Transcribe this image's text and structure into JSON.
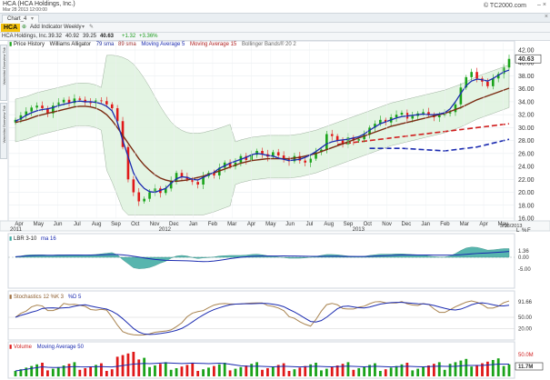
{
  "window": {
    "title": "HCA (HCA Holdings, Inc.)",
    "date": "Mar 28 2013 12:00:00",
    "brand": "© TC2000.com"
  },
  "tab": {
    "label": "Chart_4"
  },
  "toolbar": {
    "symbol": "HCA",
    "add_indicator": "Add Indicator",
    "interval": "Weekly"
  },
  "quote": {
    "name": "HCA Holdings, Inc.",
    "open": "39.32",
    "high": "40.92",
    "low": "39.25",
    "last": "40.63",
    "change": "+1.32",
    "change_pct": "+3.36%"
  },
  "legend_main": {
    "price": "Price History",
    "alligator": "Williams Alligator",
    "sma79": "79 sma",
    "sma89": "89 sma",
    "ma5": "Moving Average 5",
    "ma15": "Moving Average 15",
    "bb": "Bollinger Bands® 20 2"
  },
  "side_tabs": [
    "Watchlist Overview Tab",
    "Watchlist Overview Tab"
  ],
  "legend_lbr": {
    "name": "LBR 3-10",
    "ma": "ma 16"
  },
  "legend_stoch": {
    "name": "Stochastics 12 %K 3",
    "d": "%D 5"
  },
  "legend_vol": {
    "name": "Volume",
    "ma": "Moving Average 50"
  },
  "price_tag": "40.63",
  "date_tag": "3/28/2013",
  "scale_letters": {
    "l": "L",
    "pct": "%",
    "f": "F"
  },
  "lbr_labels": {
    "val": "1.36",
    "zero": "0.00",
    "neg": "-5.00"
  },
  "stoch_labels": {
    "val": "91.66",
    "mid": "50.00",
    "low": "20.00"
  },
  "vol_labels": {
    "top": "50.0M",
    "val": "11.7M"
  },
  "colors": {
    "up": "#1aa31a",
    "down": "#e01919",
    "sma5": "#1b2bb0",
    "sma15": "#7a2a12",
    "lbr_fill": "#3aa9a0",
    "bb_fill": "#dff3df",
    "dash_red": "#d01e1e",
    "dash_blue": "#1b2bb0"
  },
  "chart_data": {
    "type": "candlestick",
    "interval": "Weekly",
    "y_ticks": [
      "42.00",
      "40.00",
      "38.00",
      "36.00",
      "34.00",
      "32.00",
      "30.00",
      "28.00",
      "26.00",
      "24.00",
      "22.00",
      "20.00",
      "18.00",
      "16.00"
    ],
    "ylim": [
      16,
      42
    ],
    "x_month_labels": [
      "Apr",
      "May",
      "Jun",
      "Jul",
      "Aug",
      "Sep",
      "Oct",
      "Nov",
      "Dec",
      "Jan",
      "Feb",
      "Mar",
      "Apr",
      "May",
      "Jun",
      "Jul",
      "Aug",
      "Sep",
      "Oct",
      "Nov",
      "Dec",
      "Jan",
      "Feb",
      "Mar",
      "Apr",
      "May"
    ],
    "x_year_labels": [
      "2011",
      "2012",
      "2013"
    ],
    "closes": [
      31.2,
      31.9,
      32.5,
      33.1,
      33.4,
      33.0,
      32.2,
      33.4,
      33.9,
      34.3,
      33.8,
      34.5,
      34.3,
      33.9,
      33.8,
      34.2,
      34.1,
      33.6,
      33.0,
      31.0,
      27.0,
      22.0,
      20.0,
      18.6,
      19.0,
      20.0,
      20.6,
      19.9,
      20.6,
      21.8,
      23.0,
      22.4,
      22.0,
      21.6,
      21.2,
      22.5,
      23.0,
      22.6,
      23.8,
      24.6,
      24.0,
      24.6,
      25.6,
      25.0,
      25.8,
      26.4,
      25.9,
      25.5,
      26.2,
      25.7,
      25.2,
      24.8,
      25.6,
      24.9,
      24.6,
      25.2,
      26.2,
      26.6,
      29.0,
      28.7,
      28.0,
      27.4,
      28.5,
      28.0,
      28.2,
      28.9,
      30.0,
      30.6,
      31.2,
      30.8,
      31.6,
      32.0,
      32.3,
      31.4,
      31.8,
      32.2,
      32.4,
      32.0,
      31.6,
      31.9,
      32.2,
      32.4,
      33.6,
      36.2,
      37.8,
      38.6,
      37.6,
      37.1,
      36.4,
      37.6,
      38.3,
      39.3,
      40.63
    ],
    "sma5": [
      31.0,
      31.4,
      31.9,
      32.3,
      32.6,
      32.8,
      32.9,
      33.1,
      33.4,
      33.6,
      33.8,
      34.0,
      34.1,
      34.0,
      34.0,
      33.9,
      33.7,
      33.3,
      32.6,
      30.8,
      28.0,
      25.5,
      23.0,
      21.5,
      20.6,
      20.1,
      20.0,
      20.3,
      20.6,
      21.4,
      22.1,
      22.4,
      22.3,
      22.0,
      21.9,
      22.3,
      22.7,
      23.1,
      23.7,
      24.1,
      24.5,
      24.8,
      25.1,
      25.4,
      25.8,
      26.0,
      25.9,
      25.7,
      25.6,
      25.3,
      25.1,
      24.9,
      25.0,
      25.1,
      25.4,
      25.8,
      26.3,
      26.9,
      27.5,
      27.8,
      28.0,
      28.1,
      28.2,
      28.4,
      28.6,
      29.0,
      29.6,
      30.1,
      30.6,
      30.9,
      31.2,
      31.5,
      31.7,
      31.8,
      31.9,
      32.0,
      32.1,
      32.0,
      32.0,
      32.1,
      32.3,
      32.9,
      34.0,
      35.3,
      36.5,
      37.2,
      37.5,
      37.4,
      37.2,
      37.6,
      38.1,
      38.6,
      38.9
    ],
    "sma15": [
      30.8,
      31.0,
      31.2,
      31.5,
      31.8,
      32.0,
      32.2,
      32.4,
      32.6,
      32.8,
      33.0,
      33.2,
      33.3,
      33.3,
      33.2,
      33.0,
      32.6,
      32.0,
      31.1,
      30.0,
      28.8,
      27.6,
      26.4,
      25.2,
      24.2,
      23.4,
      22.7,
      22.2,
      21.9,
      21.7,
      21.7,
      21.8,
      21.9,
      22.1,
      22.3,
      22.5,
      22.8,
      23.0,
      23.3,
      23.6,
      23.9,
      24.2,
      24.5,
      24.7,
      24.9,
      25.0,
      25.1,
      25.2,
      25.2,
      25.2,
      25.2,
      25.2,
      25.3,
      25.4,
      25.6,
      25.8,
      26.0,
      26.3,
      26.6,
      26.9,
      27.2,
      27.5,
      27.8,
      28.1,
      28.4,
      28.7,
      29.0,
      29.3,
      29.6,
      29.9,
      30.2,
      30.4,
      30.6,
      30.8,
      31.0,
      31.2,
      31.4,
      31.6,
      31.8,
      32.0,
      32.2,
      32.5,
      32.8,
      33.1,
      33.5,
      33.9,
      34.3,
      34.6,
      34.9,
      35.2,
      35.5,
      35.8,
      36.1
    ],
    "dash_red": [
      [
        60,
        27.4
      ],
      [
        72,
        28.6
      ],
      [
        84,
        29.8
      ],
      [
        92,
        30.6
      ]
    ],
    "dash_blue": [
      [
        66,
        26.8
      ],
      [
        72,
        26.8
      ],
      [
        80,
        26.4
      ],
      [
        86,
        27.0
      ],
      [
        92,
        28.2
      ]
    ],
    "lbr": {
      "label": "LBR 3-10",
      "ma_label": "ma 16",
      "last": 1.36
    },
    "stochastics": {
      "label": "Stochastics 12 %K 3 %D 5",
      "last": 91.66,
      "levels": [
        50,
        20
      ]
    },
    "volume": {
      "label": "Volume Moving Average 50",
      "last": "11.7M",
      "top": "50.0M"
    }
  }
}
